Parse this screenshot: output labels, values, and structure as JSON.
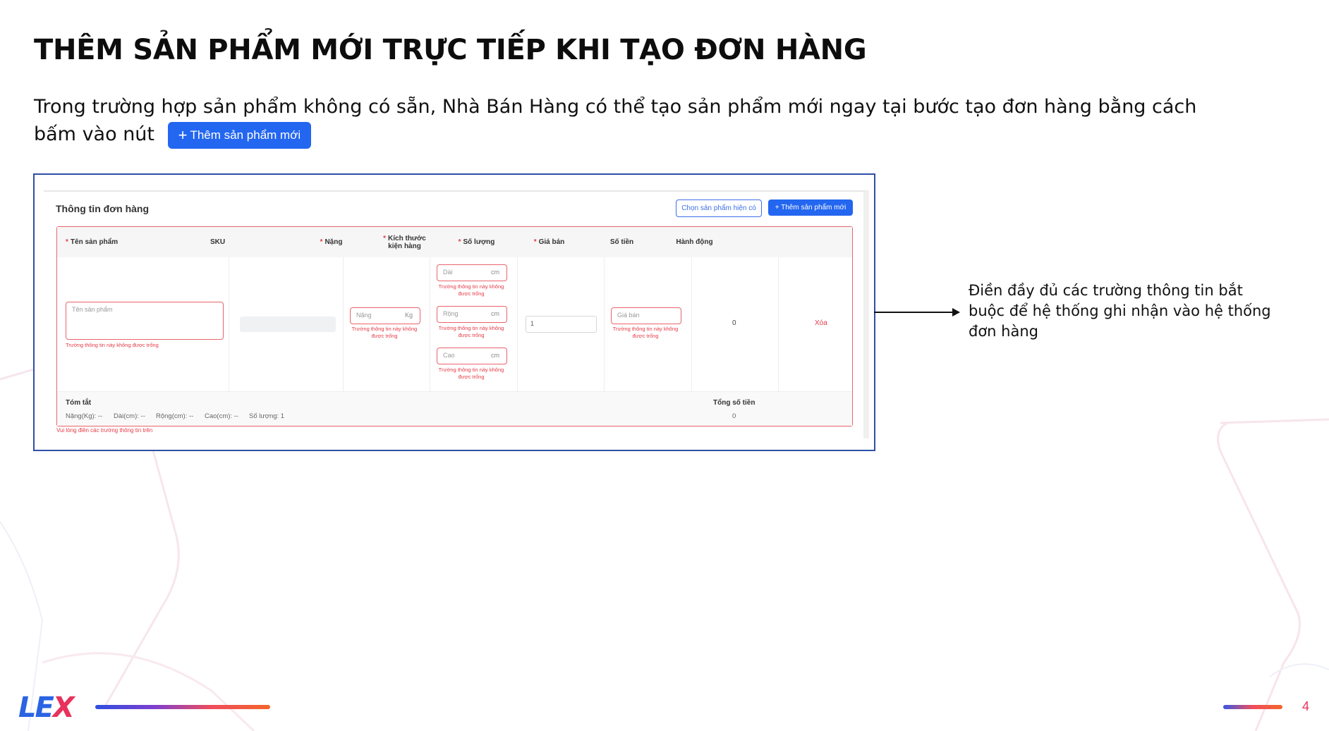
{
  "slide": {
    "title": "THÊM SẢN PHẨM MỚI TRỰC TIẾP KHI TẠO ĐƠN HÀNG",
    "intro_text": "Trong trường hợp sản phẩm không có sẵn, Nhà Bán Hàng có thể tạo sản phẩm mới ngay tại bước tạo đơn hàng bằng cách bấm vào nút",
    "inline_button_label": "Thêm sản phẩm mới",
    "note": "Điền đầy đủ các trường thông tin bắt buộc để hệ thống ghi nhận vào hệ thống đơn hàng",
    "logo_part1": "LE",
    "logo_part2": "X",
    "page_number": "4"
  },
  "order_card": {
    "title": "Thông tin đơn hàng",
    "btn_choose_existing": "Chọn sản phẩm hiện có",
    "btn_add_new": "Thêm sản phẩm mới",
    "columns": {
      "product_name": "Tên sản phẩm",
      "sku": "SKU",
      "weight": "Nặng",
      "dimensions": "Kích thước kiện hàng",
      "quantity": "Số lượng",
      "price": "Giá bán",
      "amount": "Số tiền",
      "action": "Hành động"
    },
    "row": {
      "product_name_placeholder": "Tên sản phẩm",
      "product_name_error": "Trường thông tin này không được trống",
      "weight_placeholder": "Nặng",
      "weight_unit": "Kg",
      "field_error": "Trường thông tin này không được trống",
      "length_placeholder": "Dài",
      "width_placeholder": "Rộng",
      "height_placeholder": "Cao",
      "dim_unit": "cm",
      "quantity_value": "1",
      "price_placeholder": "Giá bán",
      "amount_value": "0",
      "delete_label": "Xóa"
    },
    "summary": {
      "label": "Tóm tắt",
      "weight": "Nặng(Kg): --",
      "length": "Dài(cm): --",
      "width": "Rộng(cm): --",
      "height": "Cao(cm): --",
      "quantity": "Số lượng: 1",
      "total_label": "Tổng số tiền",
      "total_value": "0"
    },
    "footer_error": "Vui lòng điền các trường thông tin trên"
  },
  "colors": {
    "primary": "#2366f0",
    "error": "#e53945",
    "frame": "#2f4fa6",
    "logo_blue": "#2a64e3",
    "logo_red": "#e8325c"
  }
}
